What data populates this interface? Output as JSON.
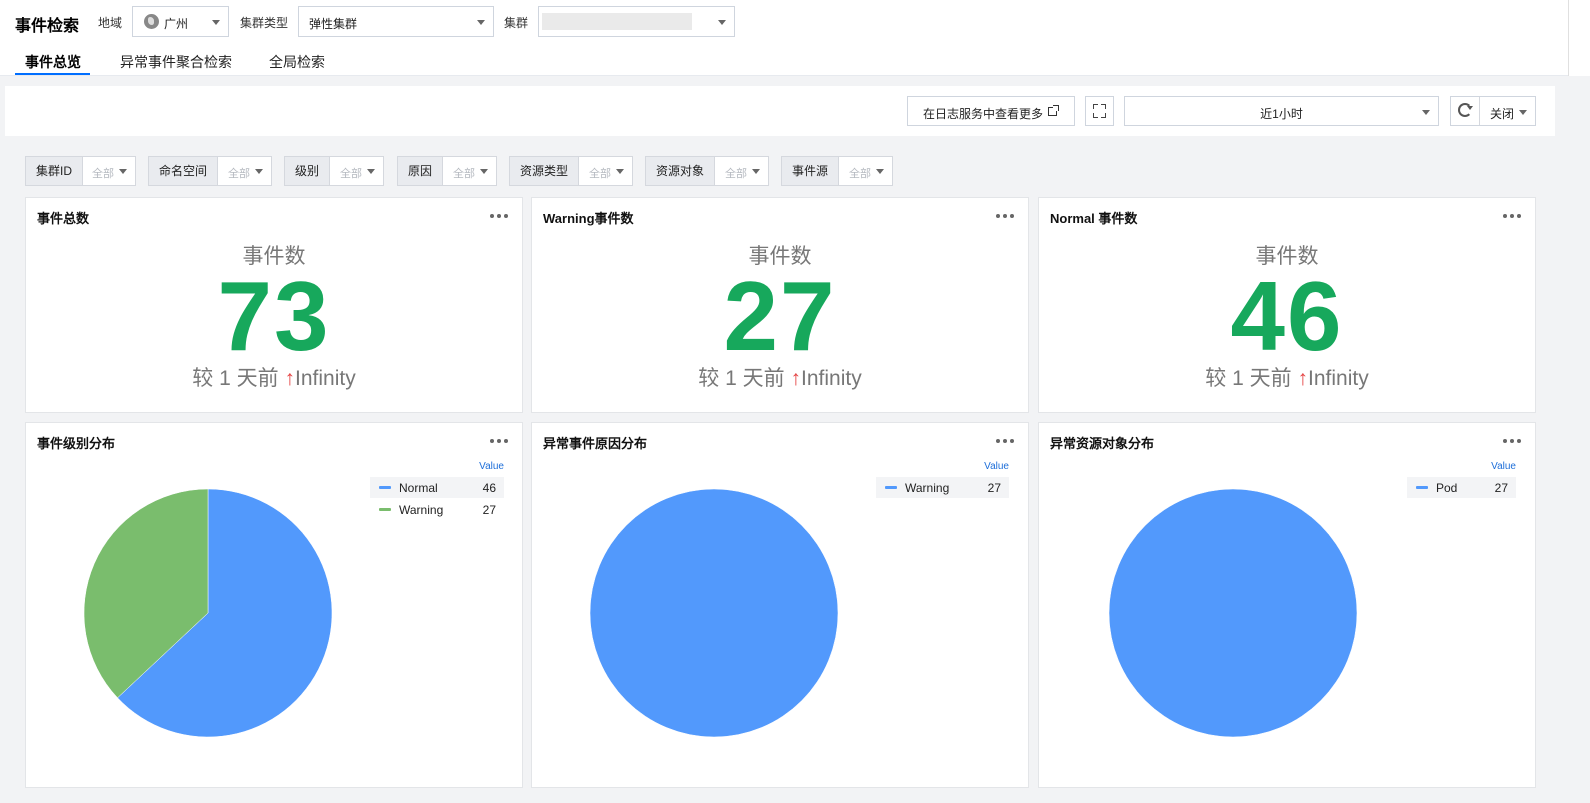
{
  "header": {
    "title": "事件检索",
    "region_label": "地域",
    "region_value": "广州",
    "cluster_type_label": "集群类型",
    "cluster_type_value": "弹性集群",
    "cluster_label": "集群"
  },
  "tabs": [
    {
      "label": "事件总览",
      "active": true
    },
    {
      "label": "异常事件聚合检索",
      "active": false
    },
    {
      "label": "全局检索",
      "active": false
    }
  ],
  "toolbar": {
    "view_more_label": "在日志服务中查看更多",
    "time_range": "近1小时",
    "refresh_label": "关闭"
  },
  "filters": [
    {
      "label": "集群ID",
      "value": "全部"
    },
    {
      "label": "命名空间",
      "value": "全部"
    },
    {
      "label": "级别",
      "value": "全部"
    },
    {
      "label": "原因",
      "value": "全部"
    },
    {
      "label": "资源类型",
      "value": "全部"
    },
    {
      "label": "资源对象",
      "value": "全部"
    },
    {
      "label": "事件源",
      "value": "全部"
    }
  ],
  "stat_cards": [
    {
      "title": "事件总数",
      "label": "事件数",
      "value": "73",
      "compare_prefix": "较 1 天前",
      "compare_arrow": "↑",
      "compare_value": "Infinity"
    },
    {
      "title": "Warning事件数",
      "label": "事件数",
      "value": "27",
      "compare_prefix": "较 1 天前",
      "compare_arrow": "↑",
      "compare_value": "Infinity"
    },
    {
      "title": "Normal 事件数",
      "label": "事件数",
      "value": "46",
      "compare_prefix": "较 1 天前",
      "compare_arrow": "↑",
      "compare_value": "Infinity"
    }
  ],
  "colors": {
    "accent": "#006eff",
    "stat_green": "#17a85c",
    "up_red": "#e54545",
    "pie_blue": "#5299fc",
    "pie_green": "#7abd6d"
  },
  "chart_data": [
    {
      "type": "pie",
      "title": "事件级别分布",
      "legend_header": "Value",
      "legend_position": "top-right",
      "slices": [
        {
          "name": "Normal",
          "value": 46,
          "color": "#5299fc"
        },
        {
          "name": "Warning",
          "value": 27,
          "color": "#7abd6d"
        }
      ]
    },
    {
      "type": "pie",
      "title": "异常事件原因分布",
      "legend_header": "Value",
      "legend_position": "top-right",
      "slices": [
        {
          "name": "Warning",
          "value": 27,
          "color": "#5299fc"
        }
      ]
    },
    {
      "type": "pie",
      "title": "异常资源对象分布",
      "legend_header": "Value",
      "legend_position": "top-right",
      "slices": [
        {
          "name": "Pod",
          "value": 27,
          "color": "#5299fc"
        }
      ]
    }
  ]
}
